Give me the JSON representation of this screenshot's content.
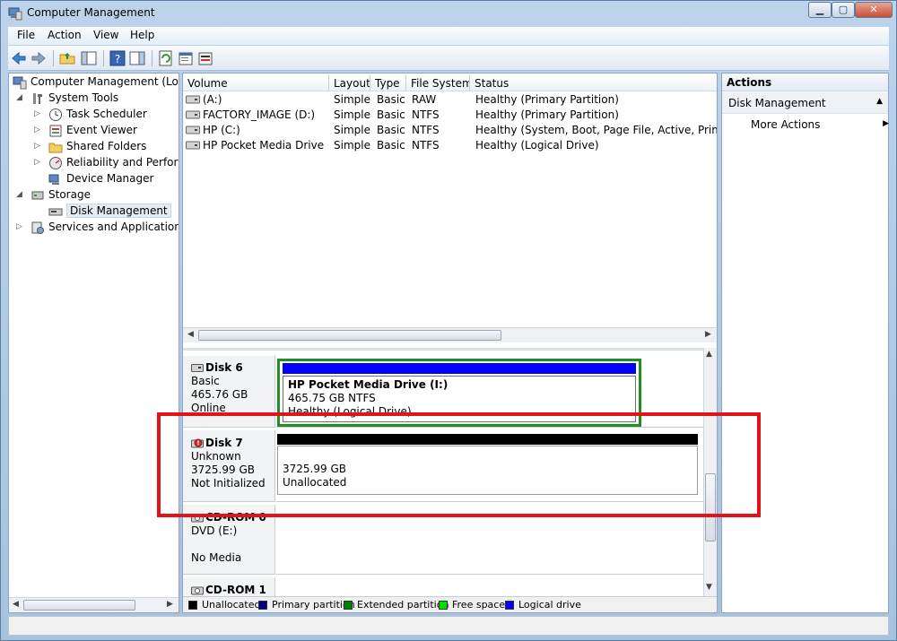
{
  "window": {
    "title": "Computer Management",
    "minimize": "▁",
    "maximize": "▢",
    "close": "✕"
  },
  "menu": [
    "File",
    "Action",
    "View",
    "Help"
  ],
  "tree": {
    "root": "Computer Management (Local",
    "system_tools": "System Tools",
    "task_scheduler": "Task Scheduler",
    "event_viewer": "Event Viewer",
    "shared_folders": "Shared Folders",
    "reliability": "Reliability and Performa",
    "device_manager": "Device Manager",
    "storage": "Storage",
    "disk_management": "Disk Management",
    "services": "Services and Applications"
  },
  "volume_list": {
    "headers": [
      "Volume",
      "Layout",
      "Type",
      "File System",
      "Status"
    ],
    "rows": [
      [
        "(A:)",
        "Simple",
        "Basic",
        "RAW",
        "Healthy (Primary Partition)"
      ],
      [
        "FACTORY_IMAGE (D:)",
        "Simple",
        "Basic",
        "NTFS",
        "Healthy (Primary Partition)"
      ],
      [
        "HP (C:)",
        "Simple",
        "Basic",
        "NTFS",
        "Healthy (System, Boot, Page File, Active, Primary Pa"
      ],
      [
        "HP Pocket Media Drive (I:)",
        "Simple",
        "Basic",
        "NTFS",
        "Healthy (Logical Drive)"
      ]
    ]
  },
  "disks": {
    "disk6": {
      "name": "Disk 6",
      "type": "Basic",
      "size": "465.76 GB",
      "state": "Online",
      "partition": {
        "name": "HP Pocket Media Drive  (I:)",
        "size": "465.75 GB NTFS",
        "status": "Healthy (Logical Drive)"
      }
    },
    "disk7": {
      "name": "Disk 7",
      "type": "Unknown",
      "size": "3725.99 GB",
      "state": "Not Initialized",
      "partition": {
        "size": "3725.99 GB",
        "status": "Unallocated"
      }
    },
    "cdrom0": {
      "name": "CD-ROM 0",
      "type": "DVD (E:)",
      "state": "No Media"
    },
    "cdrom1": {
      "name": "CD-ROM 1"
    }
  },
  "legend": [
    "Unallocated",
    "Primary partition",
    "Extended partition",
    "Free space",
    "Logical drive"
  ],
  "legend_colors": [
    "#000000",
    "#00008b",
    "#008000",
    "#00e000",
    "#0000ff"
  ],
  "actions": {
    "header": "Actions",
    "section": "Disk Management",
    "more": "More Actions"
  },
  "colors": {
    "logical_drive": "#0000ff",
    "unallocated": "#000000",
    "highlight": "#e0141b"
  }
}
